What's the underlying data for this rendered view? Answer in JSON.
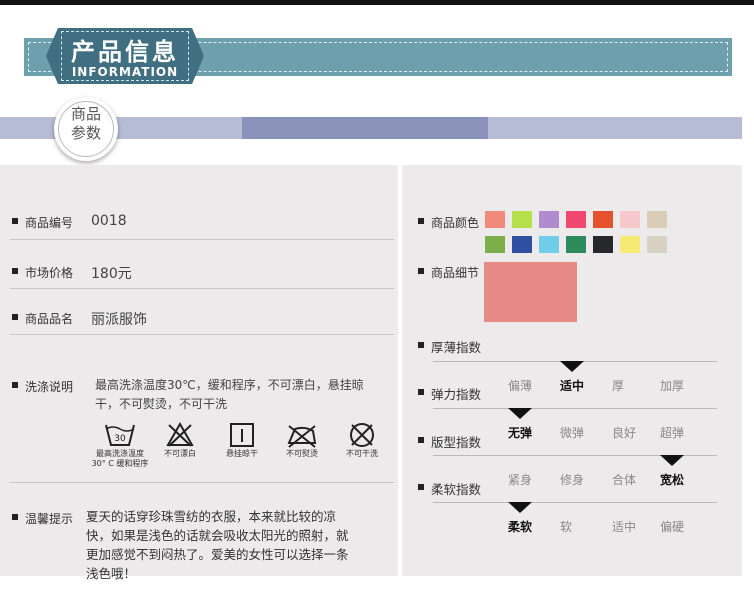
{
  "header": {
    "title_cn": "产品信息",
    "title_en": "INFORMATION",
    "section_badge": [
      "商品",
      "参数"
    ]
  },
  "product": {
    "code_label": "商品编号",
    "code_value": "0018",
    "price_label": "市场价格",
    "price_value": "180元",
    "brand_label": "商品品名",
    "brand_value": "丽派服饰",
    "wash_label": "洗涤说明",
    "wash_text": "最高洗涤温度30℃，缓和程序，不可漂白，悬挂晾干，不可熨烫，不可干洗",
    "care_icons": [
      {
        "icon": "wash-30-icon",
        "label1": "最高洗涤温度",
        "label2": "30° C 缓和程序"
      },
      {
        "icon": "no-bleach-icon",
        "label1": "不可漂白",
        "label2": ""
      },
      {
        "icon": "hang-dry-icon",
        "label1": "悬挂晾干",
        "label2": ""
      },
      {
        "icon": "no-iron-icon",
        "label1": "不可熨烫",
        "label2": ""
      },
      {
        "icon": "no-dry-clean-icon",
        "label1": "不可干洗",
        "label2": ""
      }
    ],
    "tips_label": "温馨提示",
    "tips_text": "夏天的话穿珍珠雪纺的衣服，本来就比较的凉快，如果是浅色的话就会吸收太阳光的照射，就更加感觉不到闷热了。爱美的女性可以选择一条浅色哦！"
  },
  "colors": {
    "label": "商品颜色",
    "swatches": [
      "#f28a7a",
      "#b5e04a",
      "#b08ccf",
      "#f2476f",
      "#e4512c",
      "#f7c8cb",
      "#d9cdb8",
      "#7cae4a",
      "#2f4fa2",
      "#6fcde8",
      "#2e8b5c",
      "#26282c",
      "#f4ea74",
      "#d8d2c4"
    ]
  },
  "detail": {
    "label": "商品细节",
    "fabric_color": "#e88a86"
  },
  "indices": [
    {
      "label": "厚薄指数",
      "options": [
        "偏薄",
        "适中",
        "厚",
        "加厚"
      ],
      "selected": 1
    },
    {
      "label": "弹力指数",
      "options": [
        "无弹",
        "微弹",
        "良好",
        "超弹"
      ],
      "selected": 0
    },
    {
      "label": "版型指数",
      "options": [
        "紧身",
        "修身",
        "合体",
        "宽松"
      ],
      "selected": 3
    },
    {
      "label": "柔软指数",
      "options": [
        "柔软",
        "软",
        "适中",
        "偏硬"
      ],
      "selected": 0
    }
  ]
}
